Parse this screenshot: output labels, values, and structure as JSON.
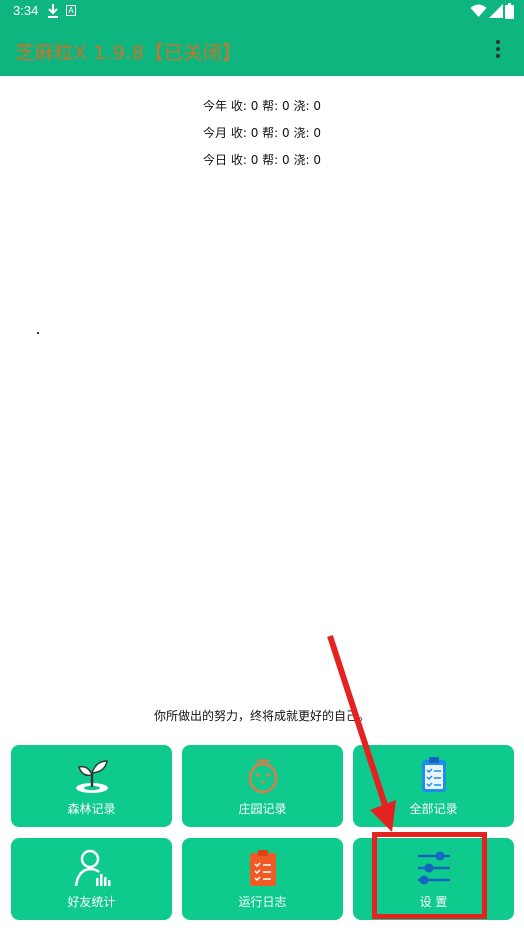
{
  "status_bar": {
    "time": "3:34",
    "notification_icons": [
      "download-icon",
      "a-badge-icon"
    ],
    "system_icons": [
      "wifi-icon",
      "signal-icon",
      "battery-icon"
    ]
  },
  "app_bar": {
    "title": "芝麻粒X 1.9.8【已关闭】",
    "menu_icon": "more-vert-icon",
    "background_color": "#0fb57e",
    "title_color": "#c9742d"
  },
  "stats": [
    "今年  收: 0 帮: 0 浇: 0",
    "今月  收: 0 帮: 0 浇: 0",
    "今日  收: 0 帮: 0 浇: 0"
  ],
  "motto": "你所做出的努力，终将成就更好的自己。",
  "tiles": [
    {
      "label": "森林记录",
      "icon": "sprout-icon"
    },
    {
      "label": "庄园记录",
      "icon": "chick-icon"
    },
    {
      "label": "全部记录",
      "icon": "clipboard-icon"
    },
    {
      "label": "好友统计",
      "icon": "user-stats-icon"
    },
    {
      "label": "运行日志",
      "icon": "log-icon"
    },
    {
      "label": "设 置",
      "icon": "sliders-icon"
    }
  ],
  "tile_color": "#0fca8d",
  "annotation_color": "#e52222"
}
